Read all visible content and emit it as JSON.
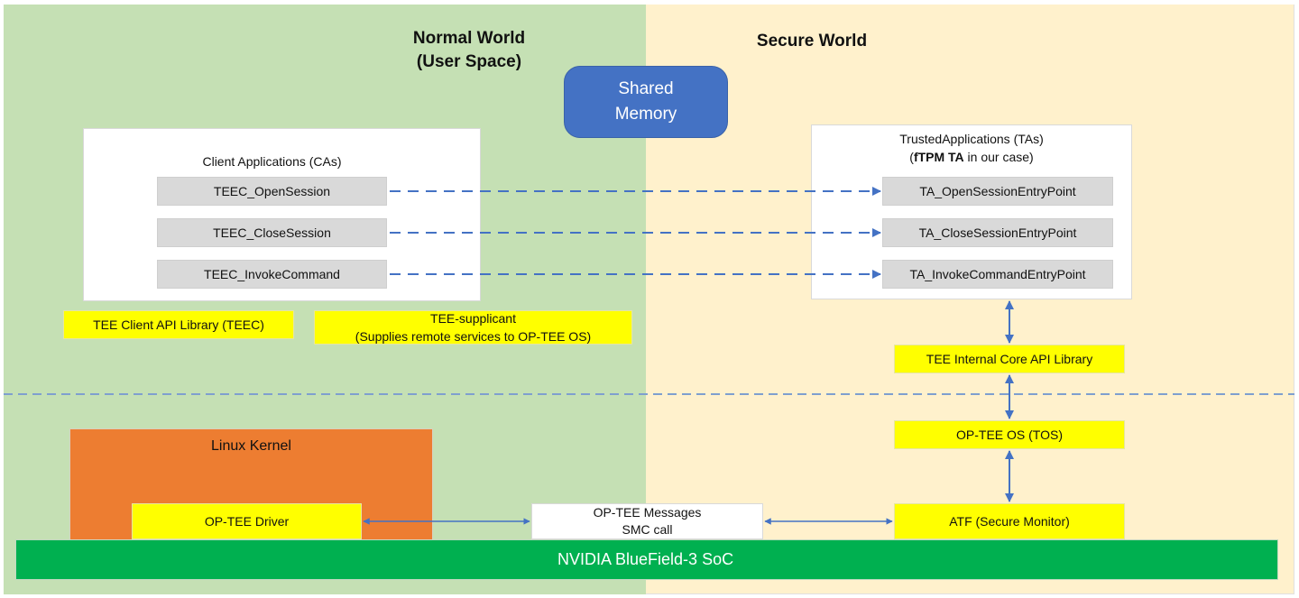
{
  "normal_world": {
    "title_line1": "Normal World",
    "title_line2": "(User Space)",
    "client_apps": {
      "title": "Client Applications (CAs)",
      "functions": [
        "TEEC_OpenSession",
        "TEEC_CloseSession",
        "TEEC_InvokeCommand"
      ]
    },
    "teec_library": "TEE Client API Library (TEEC)",
    "tee_supplicant": {
      "line1": "TEE-supplicant",
      "line2": "(Supplies remote services to OP-TEE OS)"
    },
    "linux_kernel": "Linux Kernel",
    "optee_driver": "OP-TEE Driver"
  },
  "shared_memory": {
    "line1": "Shared",
    "line2": "Memory"
  },
  "secure_world": {
    "title": "Secure World",
    "trusted_apps": {
      "title": "TrustedApplications (TAs)",
      "subtitle_bold": "fTPM TA",
      "subtitle_rest": " in our case)",
      "subtitle_open": "(",
      "entry_points": [
        "TA_OpenSessionEntryPoint",
        "TA_CloseSessionEntryPoint",
        "TA_InvokeCommandEntryPoint"
      ]
    },
    "internal_core_api": "TEE Internal Core API Library",
    "optee_os": "OP-TEE OS (TOS)",
    "atf": "ATF (Secure Monitor)"
  },
  "optee_messages": {
    "line1": "OP-TEE Messages",
    "line2": "SMC call"
  },
  "soc": "NVIDIA BlueField-3 SoC",
  "colors": {
    "normal_world_bg": "#c5e0b4",
    "secure_world_bg": "#fff1cc",
    "shared_memory": "#4472c4",
    "linux_kernel": "#ed7d31",
    "component_yellow": "#ffff00",
    "soc_green": "#00b050",
    "arrow_blue": "#4472c4"
  }
}
